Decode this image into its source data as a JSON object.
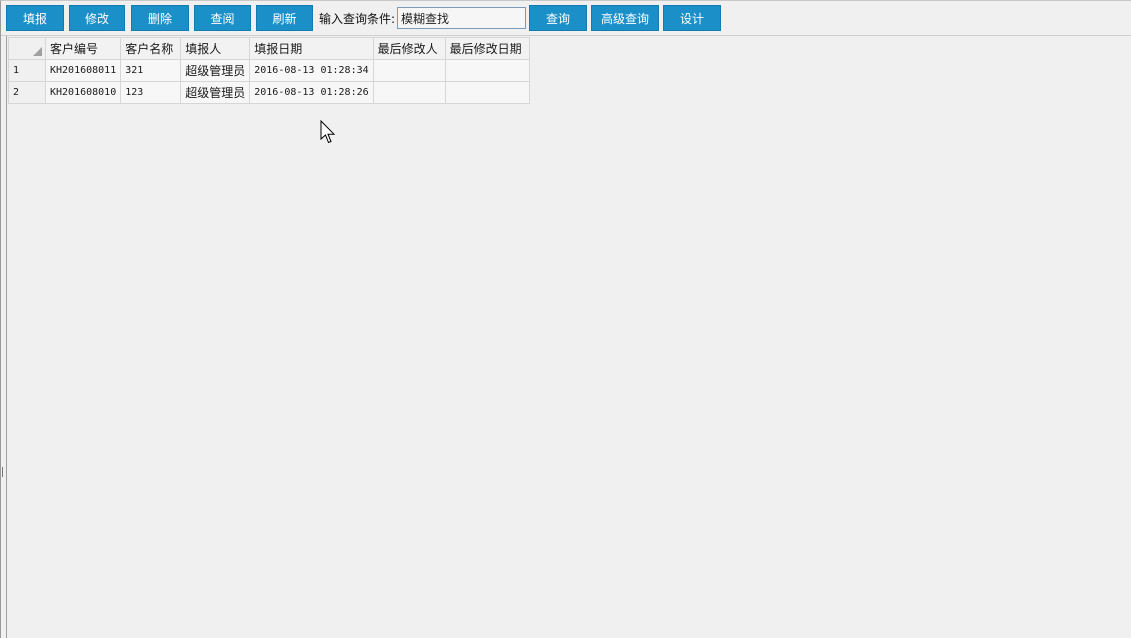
{
  "toolbar": {
    "buttons": [
      {
        "label": "填报"
      },
      {
        "label": "修改"
      },
      {
        "label": "删除"
      },
      {
        "label": "查阅"
      },
      {
        "label": "刷新"
      }
    ],
    "query_label": "输入查询条件:",
    "search_value": "模糊查找",
    "query_button": "查询",
    "advanced_query_button": "高级查询",
    "design_button": "设计"
  },
  "grid": {
    "columns": [
      "客户编号",
      "客户名称",
      "填报人",
      "填报日期",
      "最后修改人",
      "最后修改日期"
    ],
    "rows": [
      {
        "num": "1",
        "code": "KH201608011",
        "name": "321",
        "reporter": "超级管理员",
        "date": "2016-08-13 01:28:34",
        "modifier": "",
        "modified_date": ""
      },
      {
        "num": "2",
        "code": "KH201608010",
        "name": "123",
        "reporter": "超级管理员",
        "date": "2016-08-13 01:28:26",
        "modifier": "",
        "modified_date": ""
      }
    ]
  },
  "colors": {
    "button_bg": "#1b90c8",
    "background": "#f0f0f0"
  },
  "icons": {
    "cursor": "mouse-pointer-icon"
  }
}
